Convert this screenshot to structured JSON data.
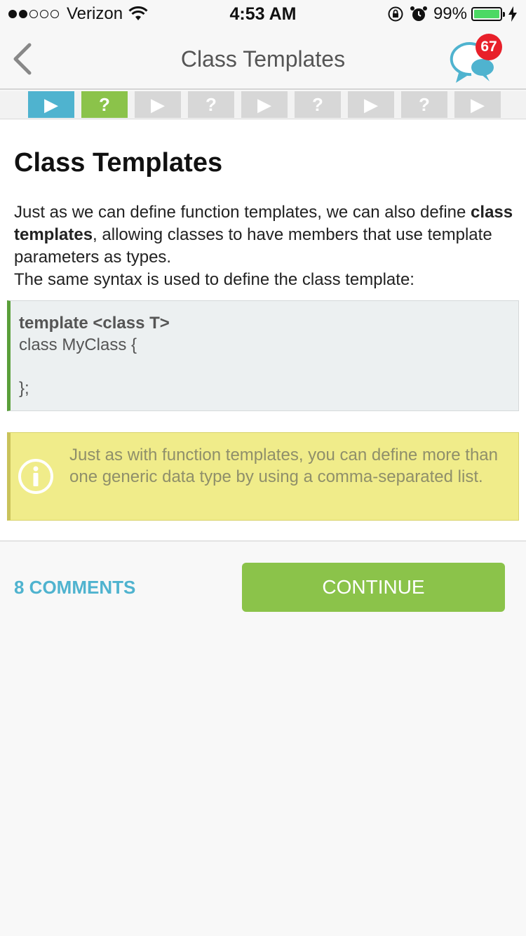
{
  "status_bar": {
    "carrier": "Verizon",
    "time": "4:53 AM",
    "battery_pct": "99%",
    "battery_level": 0.99,
    "signal_bars_filled": 2,
    "signal_bars_total": 5
  },
  "nav": {
    "title": "Class Templates",
    "comments_badge": "67",
    "accent": "#4fb3cf",
    "badge_color": "#e8202a"
  },
  "steps": [
    {
      "glyph": "▶",
      "state": "active"
    },
    {
      "glyph": "?",
      "state": "done"
    },
    {
      "glyph": "▶",
      "state": "locked"
    },
    {
      "glyph": "?",
      "state": "locked"
    },
    {
      "glyph": "▶",
      "state": "locked"
    },
    {
      "glyph": "?",
      "state": "locked"
    },
    {
      "glyph": "▶",
      "state": "locked"
    },
    {
      "glyph": "?",
      "state": "locked"
    },
    {
      "glyph": "▶",
      "state": "locked"
    }
  ],
  "lesson": {
    "title": "Class Templates",
    "para_1": "Just as we can define function templates, we can also define ",
    "para_bold": "class templates",
    "para_2": ", allowing classes to have members that use template parameters as types.",
    "para_3": "The same syntax is used to define the class template:",
    "code_line_1": "template <class T>",
    "code_line_2": "class MyClass {",
    "code_line_3": "};",
    "info_text": "Just as with function templates, you can define more than one generic data type by using a comma-separated list."
  },
  "footer": {
    "comments_label": "8 COMMENTS",
    "continue_label": "CONTINUE",
    "continue_color": "#8bc34a"
  }
}
